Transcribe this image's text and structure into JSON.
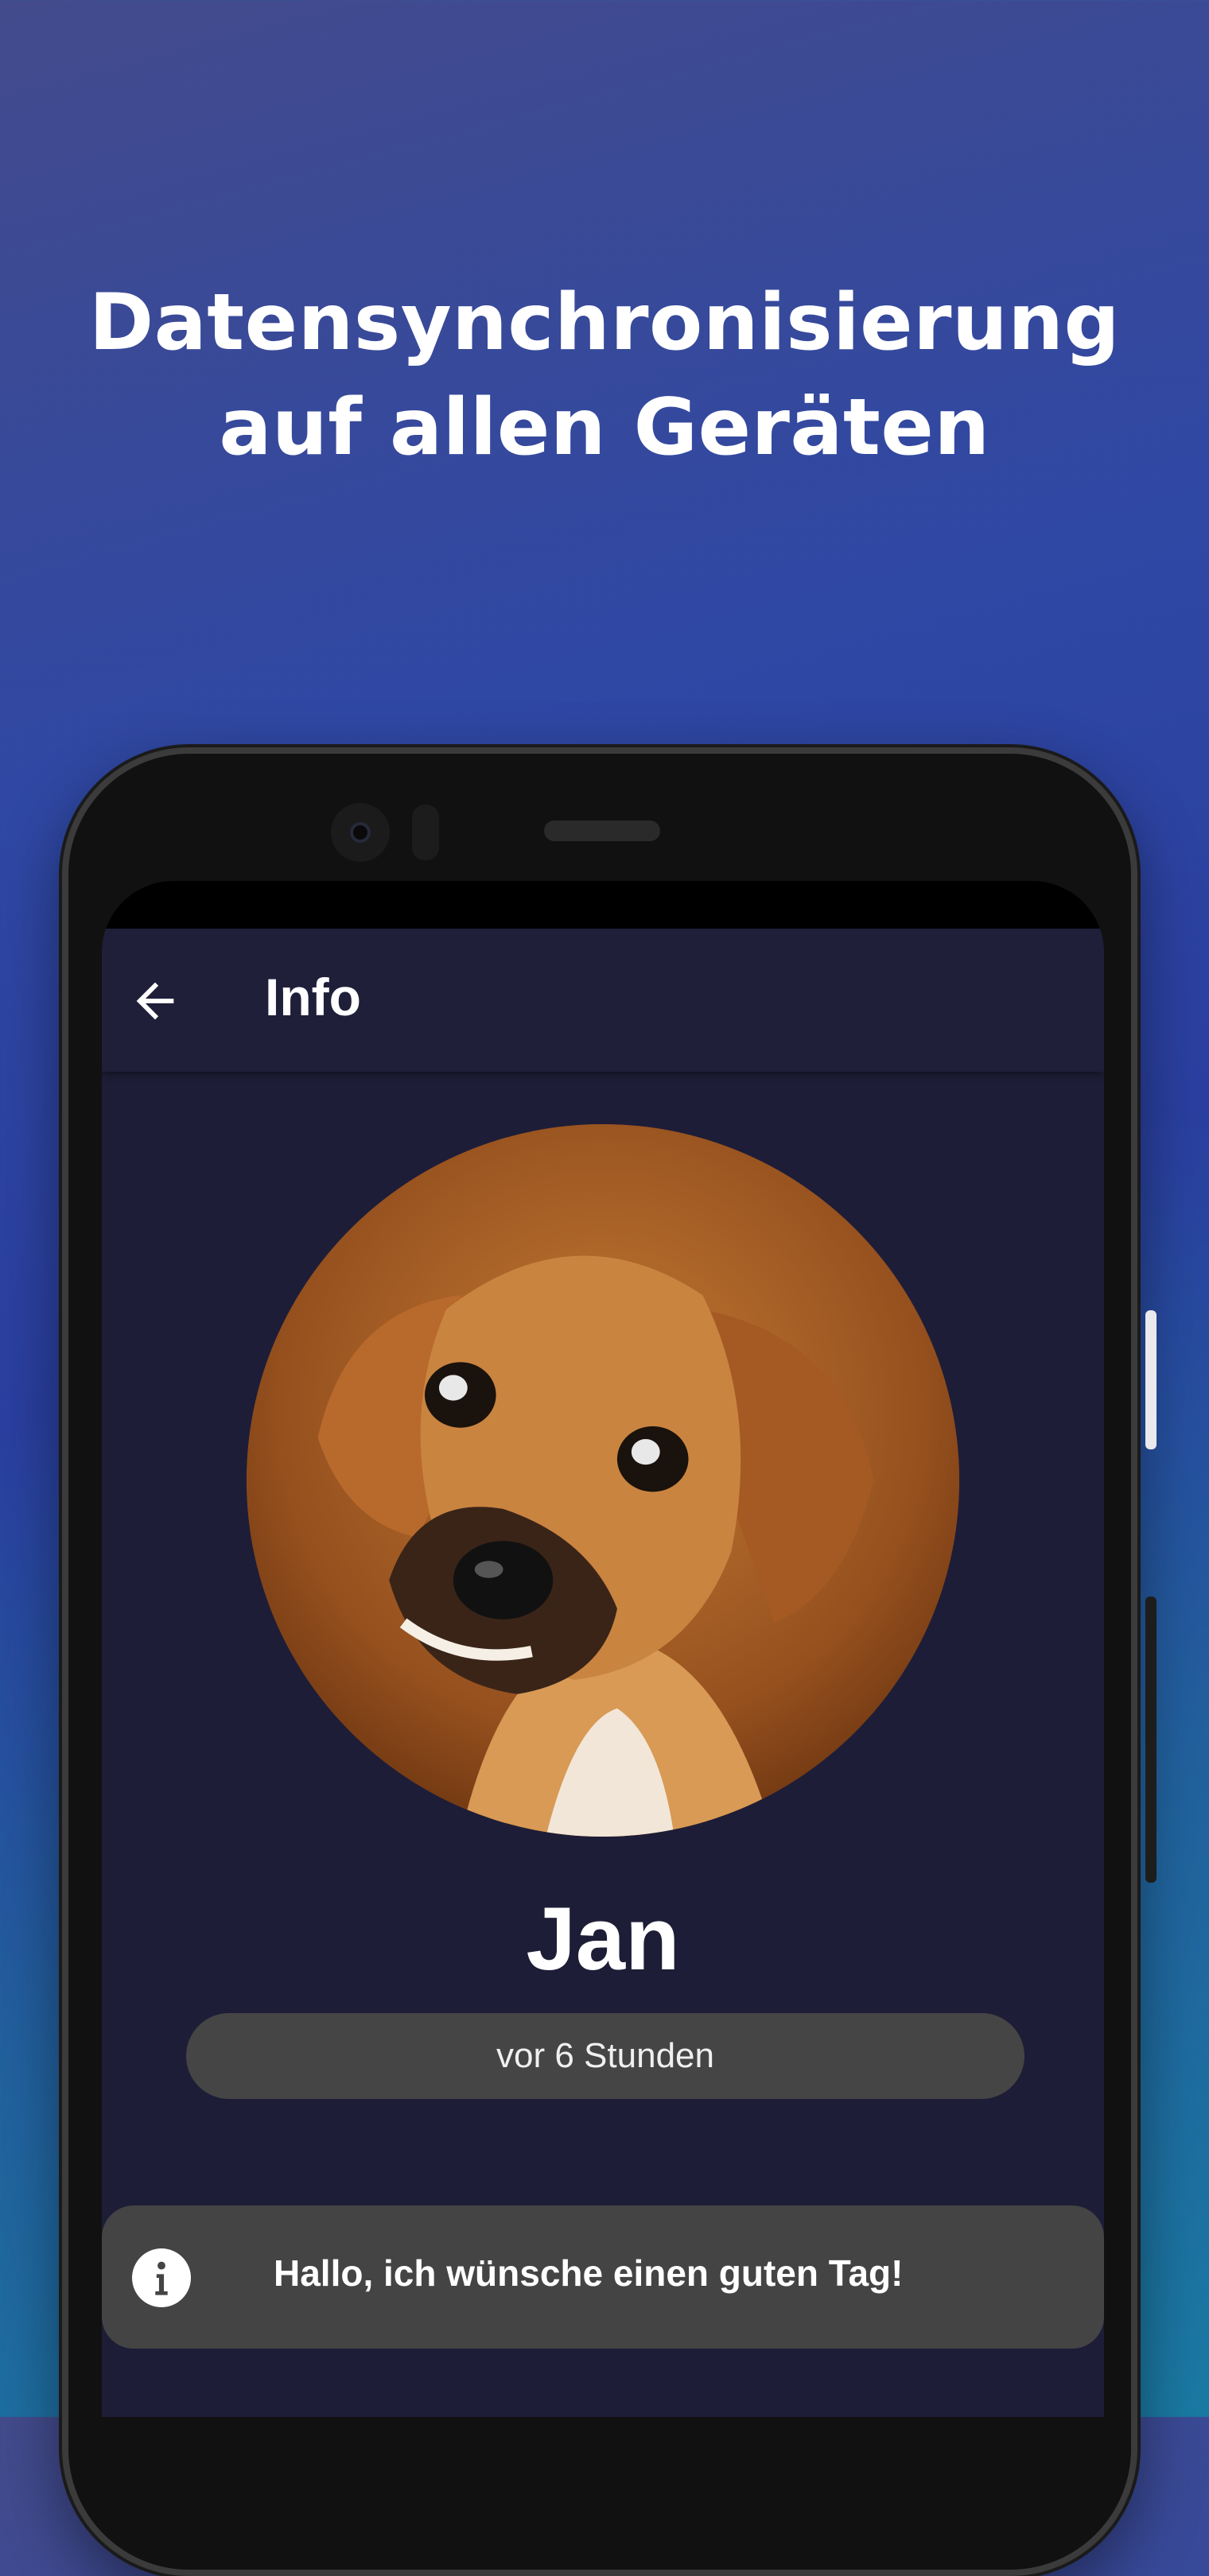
{
  "promo": {
    "headline_line1": "Datensynchronisierung",
    "headline_line2": "auf allen Geräten"
  },
  "appbar": {
    "back_icon": "arrow-left-icon",
    "title": "Info"
  },
  "profile": {
    "avatar": "dog-avatar",
    "name": "Jan",
    "last_seen": "vor 6 Stunden"
  },
  "about": {
    "icon": "info-icon",
    "status": "Hallo, ich wünsche einen guten Tag!"
  },
  "colors": {
    "screen_background": "#1e1d37",
    "appbar_background": "#201f3a",
    "pill_background": "#454545",
    "banner_background": "#444444"
  }
}
